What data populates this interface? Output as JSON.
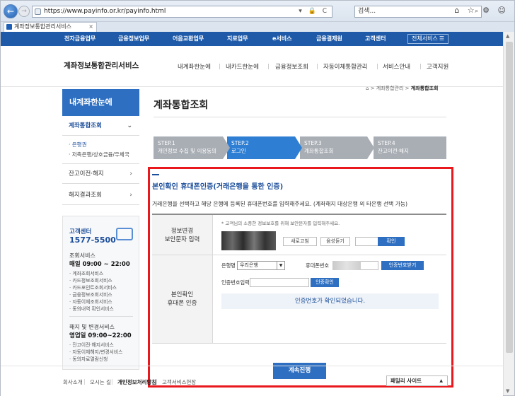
{
  "browser": {
    "url": "https://www.payinfo.or.kr/payinfo.html",
    "search_placeholder": "검색...",
    "tab_title": "계좌정보통합관리서비스",
    "tab_close": "×",
    "back": "←",
    "forward": "→",
    "addr_icons": "▾ 🔒 C",
    "search_icon": "⌕",
    "chrome_icons": "⌂ ☆ ⚙ ☺"
  },
  "gnb": {
    "items": [
      "전자금융업무",
      "금융정보업무",
      "어음교환업무",
      "지로업무",
      "e서비스",
      "금융결제원",
      "고객센터"
    ],
    "all_services": "전체서비스",
    "all_icon": "☰"
  },
  "header": {
    "logo": "계좌정보통합관리서비스",
    "menu": [
      "내계좌한눈에",
      "내카드한눈에",
      "금융정보조회",
      "자동이체통합관리",
      "서비스안내",
      "고객지원"
    ]
  },
  "sidebar": {
    "title": "내계좌한눈에",
    "items": [
      {
        "label": "계좌통합조회",
        "chev": "⌄"
      },
      {
        "label": "잔고이전·해지",
        "chev": "›"
      },
      {
        "label": "해지결과조회",
        "chev": "›"
      }
    ],
    "sub_links": [
      "· 은행권",
      "· 저축은행/상호금융/우체국"
    ],
    "cs": {
      "title": "고객센터",
      "phone": "1577-5500",
      "service_heading": "조회서비스",
      "service_hours": "매일 09:00 ~ 22:00",
      "service_items": [
        "· 계좌조회서비스",
        "· 카드정보조회서비스",
        "· 카드포인트조회서비스",
        "· 금융정보조회서비스",
        "· 자동이체조회서비스",
        "· 동의내역 확인서비스"
      ],
      "change_heading": "해지 및 변경서비스",
      "change_hours": "영업일 09:00~22:00",
      "change_items": [
        "· 잔고이전·해지서비스",
        "· 자동이체해지/변경서비스",
        "· 동의자료열람신청"
      ]
    }
  },
  "main": {
    "breadcrumb": {
      "home_icon": "⌂",
      "sep": ">",
      "l1": "계좌통합관리",
      "l2": "계좌통합조회"
    },
    "title": "계좌통합조회",
    "steps": [
      {
        "num": "STEP.1",
        "label": "개인정보 수집 및 이용동의",
        "color": "#a9aeb5"
      },
      {
        "num": "STEP.2",
        "label": "로그인",
        "color": "#2e7fd4"
      },
      {
        "num": "STEP.3",
        "label": "계좌통합조회",
        "color": "#a9aeb5"
      },
      {
        "num": "STEP.4",
        "label": "잔고이전·해지",
        "color": "#a9aeb5"
      }
    ],
    "auth": {
      "title": "본인확인 휴대폰인증(거래은행을 통한 인증)",
      "desc": "거래은행을 선택하고 해당 은행에 등록된 휴대폰번호를 입력해주세요. (계좌해지 대상은행 외 타은행 선택 가능)",
      "security_label_1": "정보변경",
      "security_label_2": "보안문자 입력",
      "security_note": "* 고객님의 소중한 정보보호를 위해 보안문자를 입력해주세요.",
      "refresh_btn": "새로고침",
      "audio_btn": "음성듣기",
      "confirm_btn": "확인",
      "phone_label_1": "본인확인",
      "phone_label_2": "휴대폰 인증",
      "bank_label": "은행명",
      "bank_value": "우리은행",
      "select_arrow": "▼",
      "phone_num_label": "휴대폰번호",
      "send_code_btn": "인증번호받기",
      "code_label": "인증번호입력",
      "verify_btn": "인증확인",
      "verified_msg": "인증번호가 확인되었습니다.",
      "proceed_btn": "계속진행"
    }
  },
  "footer": {
    "links": [
      "회사소개",
      "오시는 길",
      "개인정보처리방침",
      "고객서비스헌장"
    ],
    "sep": "|",
    "family_site": "패밀리 사이트",
    "family_arrow": "▲"
  },
  "scrollbar": {
    "up": "▲",
    "down": "▼"
  }
}
